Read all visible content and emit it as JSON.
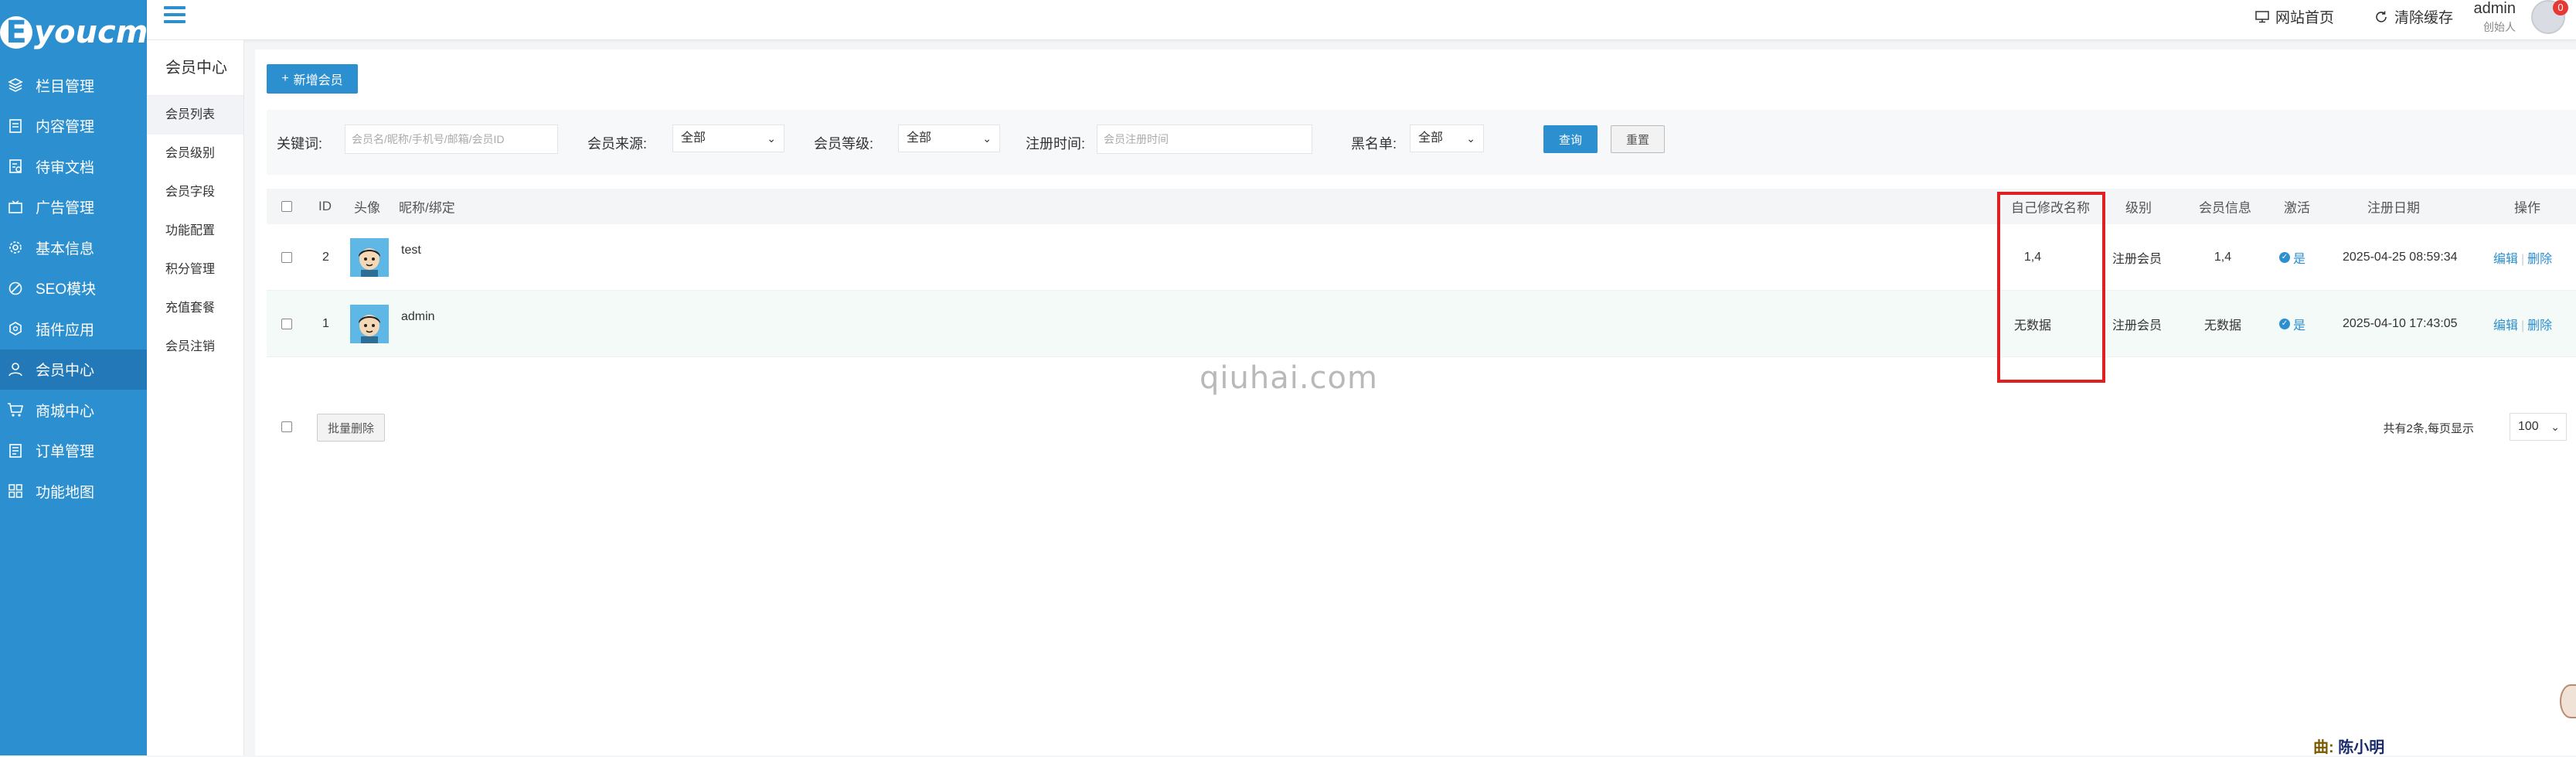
{
  "brand": {
    "logo_text": "Eyoucms"
  },
  "sidebar": {
    "items": [
      {
        "label": "栏目管理",
        "icon": "layers-icon"
      },
      {
        "label": "内容管理",
        "icon": "document-icon"
      },
      {
        "label": "待审文档",
        "icon": "review-icon"
      },
      {
        "label": "广告管理",
        "icon": "ad-icon"
      },
      {
        "label": "基本信息",
        "icon": "gear-icon"
      },
      {
        "label": "SEO模块",
        "icon": "seo-icon"
      },
      {
        "label": "插件应用",
        "icon": "plugin-icon"
      },
      {
        "label": "会员中心",
        "icon": "user-icon",
        "active": true
      },
      {
        "label": "商城中心",
        "icon": "cart-icon"
      },
      {
        "label": "订单管理",
        "icon": "order-icon"
      },
      {
        "label": "功能地图",
        "icon": "grid-icon"
      }
    ]
  },
  "topbar": {
    "site_home": "网站首页",
    "clear_cache": "清除缓存",
    "user_name": "admin",
    "user_role": "创始人",
    "badge_count": "0"
  },
  "subnav": {
    "title": "会员中心",
    "items": [
      "会员列表",
      "会员级别",
      "会员字段",
      "功能配置",
      "积分管理",
      "充值套餐",
      "会员注销"
    ]
  },
  "toolbar": {
    "add_member": "新增会员"
  },
  "filters": {
    "keyword_label": "关键词:",
    "keyword_placeholder": "会员名/昵称/手机号/邮箱/会员ID",
    "source_label": "会员来源:",
    "source_value": "全部",
    "level_label": "会员等级:",
    "level_value": "全部",
    "regtime_label": "注册时间:",
    "regtime_placeholder": "会员注册时间",
    "blacklist_label": "黑名单:",
    "blacklist_value": "全部",
    "search_button": "查询",
    "reset_button": "重置"
  },
  "table": {
    "headers": {
      "id": "ID",
      "avatar": "头像",
      "nickname": "昵称/绑定",
      "custom_name": "自己修改名称",
      "level": "级别",
      "member_info": "会员信息",
      "active": "激活",
      "reg_date": "注册日期",
      "actions": "操作"
    },
    "rows": [
      {
        "id": "2",
        "nickname": "test",
        "custom_name": "1,4",
        "level": "注册会员",
        "member_info": "1,4",
        "active": "是",
        "reg_date": "2025-04-25 08:59:34",
        "edit": "编辑",
        "delete": "删除"
      },
      {
        "id": "1",
        "nickname": "admin",
        "custom_name": "无数据",
        "level": "注册会员",
        "member_info": "无数据",
        "active": "是",
        "reg_date": "2025-04-10 17:43:05",
        "edit": "编辑",
        "delete": "删除"
      }
    ]
  },
  "footer": {
    "batch_delete": "批量删除",
    "pager_text": "共有2条,每页显示",
    "page_size": "100"
  },
  "watermark": "qiuhai.com",
  "signature": {
    "prefix": "曲:",
    "name": "陈小明"
  },
  "colors": {
    "primary": "#2c8fcf",
    "highlight": "#e02020"
  }
}
